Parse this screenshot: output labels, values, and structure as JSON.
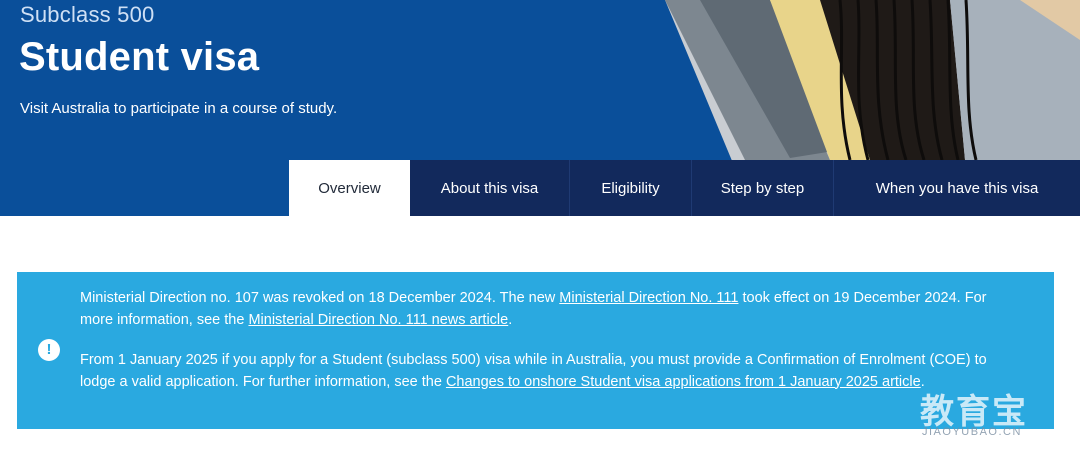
{
  "hero": {
    "eyebrow": "Subclass 500",
    "title": "Student visa",
    "subtitle": "Visit Australia to participate in a course of study."
  },
  "tabs": [
    {
      "label": "Overview",
      "active": true
    },
    {
      "label": "About this visa",
      "active": false
    },
    {
      "label": "Eligibility",
      "active": false
    },
    {
      "label": "Step by step",
      "active": false
    },
    {
      "label": "When you have this visa",
      "active": false
    }
  ],
  "alert": {
    "icon": "info-icon",
    "icon_glyph": "!",
    "p1": {
      "t1": "Ministerial Direction no. 107 was revoked on 18 December 2024. The new ",
      "link1": "Ministerial Direction No. 111",
      "t2": " took effect on 19 December 2024. For more information, see the ",
      "link2": "Ministerial Direction No. 111 news article",
      "t3": "."
    },
    "p2": {
      "t1": "From 1 January 2025 if you apply for a Student (subclass 500) visa while in Australia, you must provide a Confirmation of Enrolment (COE) to lodge a valid application. For further information, see the ",
      "link1": "Changes to onshore Student visa applications from 1 January 2025 article",
      "t2": "."
    }
  },
  "watermark": {
    "cn": "教育宝",
    "en": "JIAOYUBAO.CN"
  },
  "colors": {
    "hero_bg": "#0a4f9a",
    "tab_bg": "#12295c",
    "alert_bg": "#2aa9e0"
  }
}
